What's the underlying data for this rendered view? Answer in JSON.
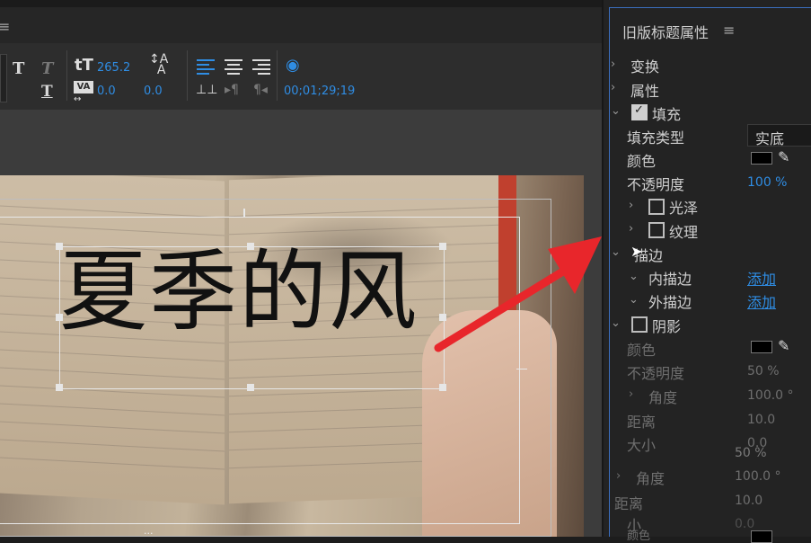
{
  "toolbar": {
    "bold_glyph": "T",
    "italic_glyph": "T",
    "underline_glyph": "T",
    "font_size_value": "265.2",
    "tracking_value": "0.0",
    "leading_value": "0.0",
    "timecode": "00;01;29;19",
    "menu_icon": "≡"
  },
  "canvas": {
    "title_text": "夏季的风",
    "subtitle_text": "..."
  },
  "panel": {
    "title": "旧版标题属性",
    "menu_icon": "≡",
    "transform_label": "变换",
    "properties_label": "属性",
    "fill_label": "填充",
    "fill_type_label": "填充类型",
    "fill_type_value": "实底",
    "color_label": "颜色",
    "opacity_label": "不透明度",
    "opacity_value": "100 %",
    "sheen_label": "光泽",
    "texture_label": "纹理",
    "stroke_label": "描边",
    "inner_stroke_label": "内描边",
    "outer_stroke_label": "外描边",
    "add_label": "添加",
    "shadow_label": "阴影",
    "shadow_color_label": "颜色",
    "shadow_opacity_label": "不透明度",
    "shadow_opacity_value": "50 %",
    "angle_label": "角度",
    "angle_value": "100.0 °",
    "distance_label": "距离",
    "distance_value": "10.0",
    "size_label": "大小",
    "size_value": "0.0",
    "ghost_opacity_value": "50 %",
    "ghost_angle_label": "角度",
    "ghost_angle_value": "100.0 °",
    "ghost_distance_label": "距离",
    "ghost_distance_value": "10.0",
    "ghost_size_label": "小",
    "ghost_size_value": "0.0",
    "ghost_color_label": "颜色"
  },
  "colors": {
    "accent_blue": "#2f8de4",
    "arrow_red": "#e8262b",
    "panel_bg": "#232323"
  }
}
